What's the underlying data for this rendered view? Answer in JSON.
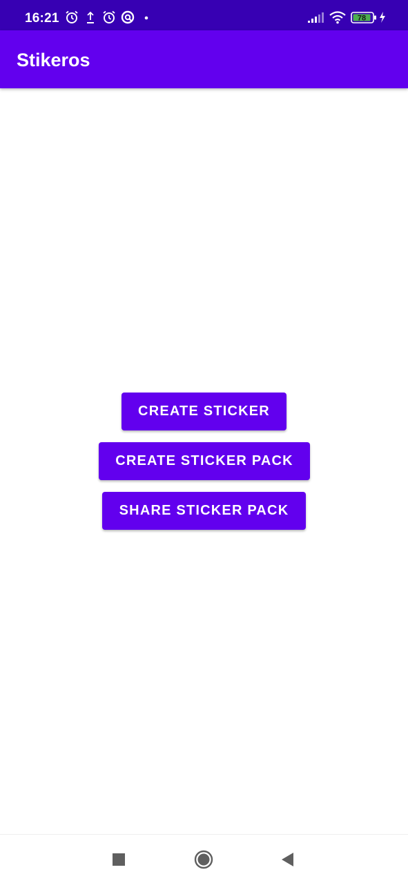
{
  "status_bar": {
    "time": "16:21",
    "battery_level": "78",
    "icons": [
      "alarm-icon",
      "upload-icon",
      "alarm-icon",
      "app-notification-icon",
      "dot-icon",
      "signal-icon",
      "wifi-icon",
      "battery-icon",
      "charging-icon"
    ]
  },
  "app_bar": {
    "title": "Stikeros"
  },
  "main": {
    "create_sticker_label": "CREATE STICKER",
    "create_sticker_pack_label": "CREATE STICKER PACK",
    "share_sticker_pack_label": "SHARE STICKER PACK"
  },
  "nav_bar": {
    "icons": [
      "recents-square-icon",
      "home-circle-icon",
      "back-triangle-icon"
    ]
  },
  "colors": {
    "status_bar": "#3700B3",
    "primary": "#6200EE",
    "background": "#FFFFFF",
    "on_primary": "#FFFFFF",
    "battery_fill": "#4CAF50"
  }
}
